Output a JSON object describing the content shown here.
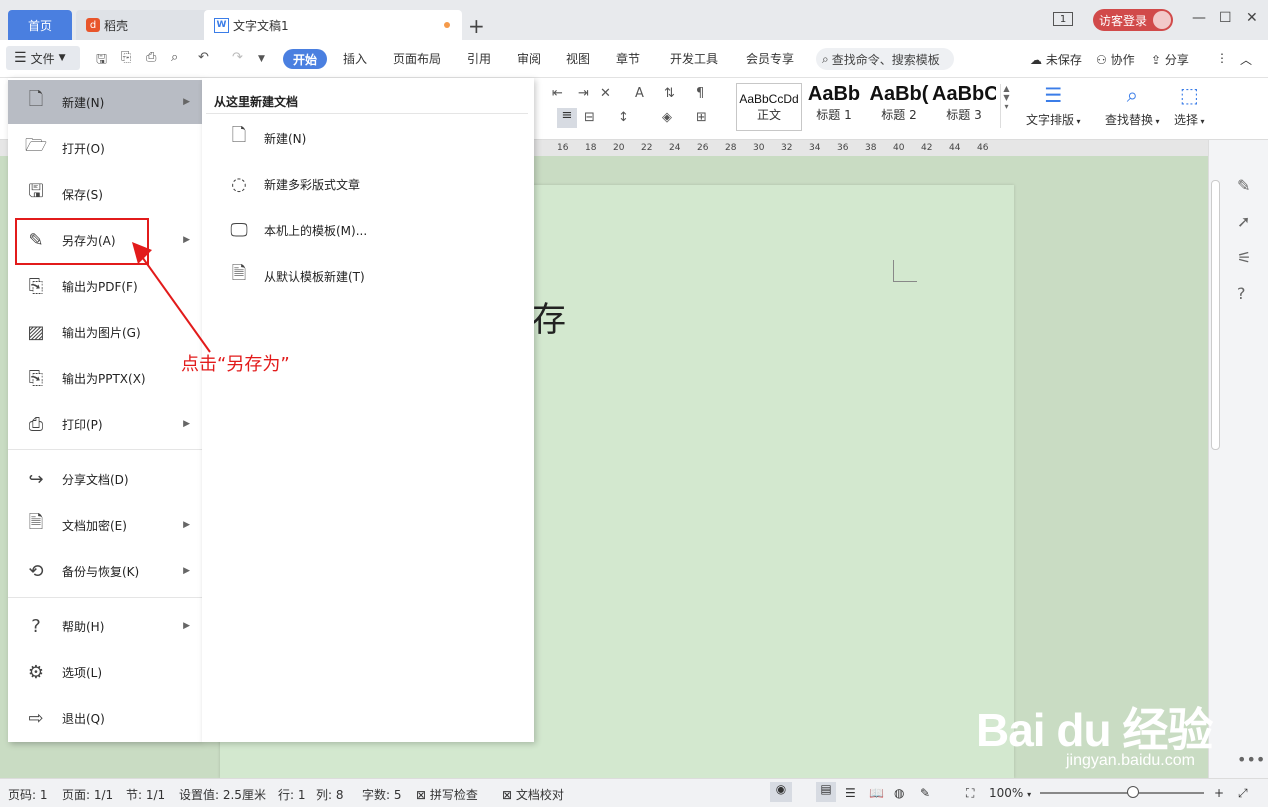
{
  "titlebar": {
    "tabs": [
      {
        "label": "首页"
      },
      {
        "label": "稻壳"
      },
      {
        "label": "文字文稿1"
      }
    ],
    "new_tab": "+",
    "page_indicator": "1",
    "login_label": "访客登录"
  },
  "toolbar": {
    "file_label": "文件",
    "ribbon_tabs": [
      "开始",
      "插入",
      "页面布局",
      "引用",
      "审阅",
      "视图",
      "章节",
      "开发工具",
      "会员专享"
    ],
    "search_placeholder": "查找命令、搜索模板",
    "unsaved": "未保存",
    "collaborate": "协作",
    "share": "分享"
  },
  "ribbon": {
    "styles": [
      {
        "sample": "AaBbCcDd",
        "label": "正文"
      },
      {
        "sample": "AaBb",
        "label": "标题 1"
      },
      {
        "sample": "AaBb(",
        "label": "标题 2"
      },
      {
        "sample": "AaBbC",
        "label": "标题 3"
      }
    ],
    "text_layout": "文字排版",
    "find_replace": "查找替换",
    "select": "选择"
  },
  "ruler": {
    "ticks": [
      "16",
      "18",
      "20",
      "22",
      "24",
      "26",
      "28",
      "30",
      "32",
      "34",
      "36",
      "38",
      "40",
      "42",
      "44",
      "46"
    ]
  },
  "document": {
    "text": "存"
  },
  "file_menu": {
    "items": [
      {
        "label": "新建(N)",
        "icon": "new-doc-icon",
        "has_arrow": true
      },
      {
        "label": "打开(O)",
        "icon": "folder-icon",
        "has_arrow": false
      },
      {
        "label": "保存(S)",
        "icon": "save-icon",
        "has_arrow": false
      },
      {
        "label": "另存为(A)",
        "icon": "save-as-icon",
        "has_arrow": true
      },
      {
        "label": "输出为PDF(F)",
        "icon": "pdf-icon",
        "has_arrow": false
      },
      {
        "label": "输出为图片(G)",
        "icon": "image-icon",
        "has_arrow": false
      },
      {
        "label": "输出为PPTX(X)",
        "icon": "pptx-icon",
        "has_arrow": false
      },
      {
        "label": "打印(P)",
        "icon": "printer-icon",
        "has_arrow": true
      },
      {
        "label": "分享文档(D)",
        "icon": "share-icon",
        "has_arrow": false
      },
      {
        "label": "文档加密(E)",
        "icon": "lock-doc-icon",
        "has_arrow": true
      },
      {
        "label": "备份与恢复(K)",
        "icon": "backup-icon",
        "has_arrow": true
      },
      {
        "label": "帮助(H)",
        "icon": "help-icon",
        "has_arrow": true
      },
      {
        "label": "选项(L)",
        "icon": "gear-icon",
        "has_arrow": false
      },
      {
        "label": "退出(Q)",
        "icon": "exit-icon",
        "has_arrow": false
      }
    ]
  },
  "submenu": {
    "title": "从这里新建文档",
    "items": [
      {
        "label": "新建(N)"
      },
      {
        "label": "新建多彩版式文章"
      },
      {
        "label": "本机上的模板(M)..."
      },
      {
        "label": "从默认模板新建(T)"
      }
    ]
  },
  "annotation": {
    "text": "点击“另存为”",
    "color": "#e21b1b"
  },
  "statusbar": {
    "page_no": "页码: 1",
    "page": "页面: 1/1",
    "section": "节: 1/1",
    "setting": "设置值: 2.5厘米",
    "row": "行: 1",
    "col": "列: 8",
    "words": "字数: 5",
    "spell_check": "拼写检查",
    "proofread": "文档校对",
    "zoom": "100%"
  },
  "watermark": {
    "brand": "Bai du 经验",
    "url": "jingyan.baidu.com"
  },
  "colors": {
    "accent": "#4a7fe0",
    "page_bg": "#d3e8cf",
    "annotation": "#e21b1b"
  }
}
